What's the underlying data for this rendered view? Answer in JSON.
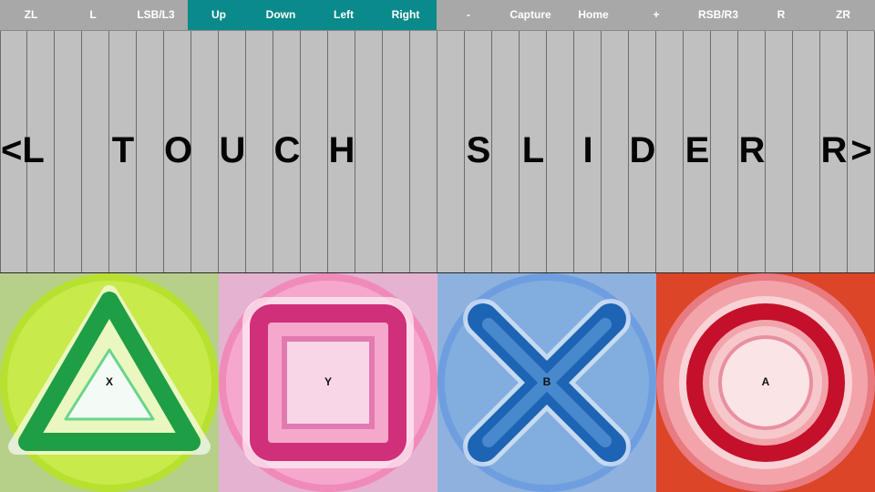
{
  "top_bar": {
    "left_buttons": [
      {
        "label": "ZL"
      },
      {
        "label": "L"
      },
      {
        "label": "LSB/L3"
      }
    ],
    "dpad_buttons": [
      {
        "label": "Up"
      },
      {
        "label": "Down"
      },
      {
        "label": "Left"
      },
      {
        "label": "Right"
      }
    ],
    "right_buttons": [
      {
        "label": "-"
      },
      {
        "label": "Capture"
      },
      {
        "label": "Home"
      },
      {
        "label": "+"
      },
      {
        "label": "RSB/R3"
      },
      {
        "label": "R"
      },
      {
        "label": "ZR"
      }
    ],
    "dpad_highlight_color": "#0a8a8a"
  },
  "touch_slider": {
    "strip_count": 32,
    "chars": [
      "<L",
      "",
      "",
      "",
      "T",
      "",
      "O",
      "",
      "U",
      "",
      "C",
      "",
      "H",
      "",
      "",
      "",
      "",
      "S",
      "",
      "L",
      "",
      "I",
      "",
      "D",
      "",
      "E",
      "",
      "R",
      "",
      "",
      "R",
      ">"
    ]
  },
  "face_buttons": [
    {
      "label": "X",
      "shape": "triangle-icon",
      "background": "#b6d08a",
      "accent": "#1e9e45"
    },
    {
      "label": "Y",
      "shape": "square-icon",
      "background": "#e6b2d2",
      "accent": "#d0307a"
    },
    {
      "label": "B",
      "shape": "cross-icon",
      "background": "#8fb1de",
      "accent": "#1e64b4"
    },
    {
      "label": "A",
      "shape": "circle-icon",
      "background": "#dc4527",
      "accent": "#c4102a"
    }
  ]
}
